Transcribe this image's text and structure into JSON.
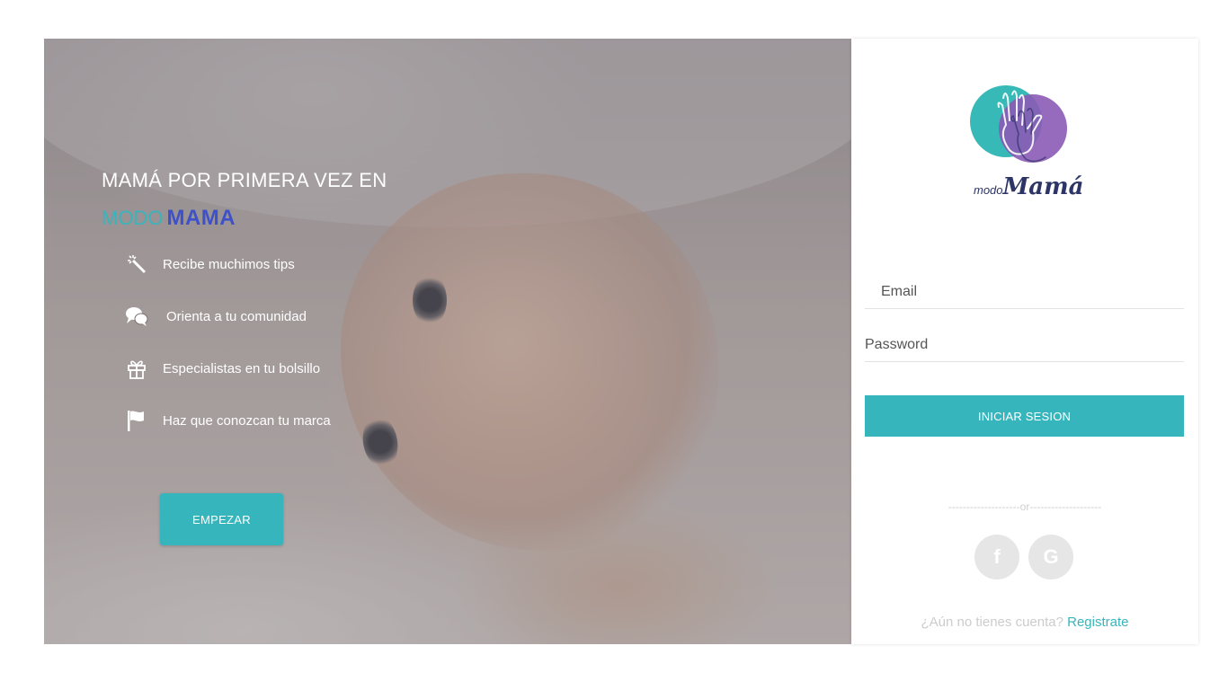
{
  "hero": {
    "headline_line1": "MAMÁ POR PRIMERA VEZ EN",
    "headline_modo": "MODO",
    "headline_mama": "MAMA",
    "features": [
      {
        "icon": "magic-wand-icon",
        "label": "Recibe muchimos tips"
      },
      {
        "icon": "chat-bubbles-icon",
        "label": "Orienta a tu comunidad"
      },
      {
        "icon": "gift-icon",
        "label": "Especialistas en tu bolsillo"
      },
      {
        "icon": "flag-icon",
        "label": "Haz que conozcan tu marca"
      }
    ],
    "start_button": "EMPEZAR"
  },
  "login": {
    "logo_small": "modo",
    "logo_large": "Mamá",
    "email_placeholder": "Email",
    "password_placeholder": "Password",
    "submit_label": "INICIAR SESION",
    "or_text": "--------------------or--------------------",
    "facebook_label": "f",
    "google_label": "G",
    "signup_prompt": "¿Aún no tienes cuenta?",
    "signup_link": "Registrate"
  },
  "colors": {
    "accent": "#36b5bd",
    "mama_blue": "#3f51c8",
    "logo_teal": "#37b9b7",
    "logo_purple": "#8b5ab5"
  }
}
